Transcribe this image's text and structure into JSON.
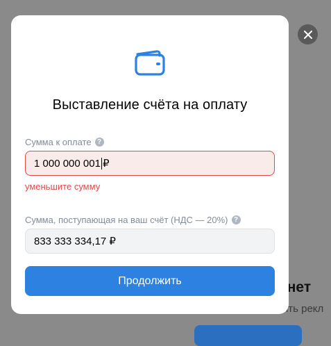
{
  "background": {
    "heading_fragment": "и нет",
    "subtext_fragment": "тить рекл"
  },
  "modal": {
    "title": "Выставление счёта на оплату",
    "amount_field": {
      "label": "Сумма к оплате",
      "value_before_caret": "1 000 000 001",
      "currency": "₽",
      "error": "уменьшите сумму"
    },
    "received_field": {
      "label": "Сумма, поступающая на ваш счёт (НДС — 20%)",
      "value": "833 333 334,17 ₽"
    },
    "continue_label": "Продолжить",
    "help_glyph": "?"
  },
  "icons": {
    "header": "wallet-icon",
    "close": "close-icon",
    "help": "question-icon"
  },
  "colors": {
    "accent": "#2d81e0",
    "error": "#e64646",
    "error_bg": "#faebeb",
    "overlay": "#8a8a8a"
  }
}
